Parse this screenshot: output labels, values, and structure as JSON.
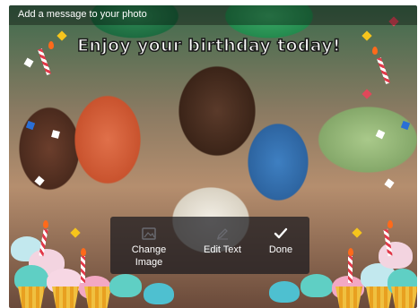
{
  "header": {
    "instruction": "Add a message to your photo"
  },
  "overlay": {
    "banner_text": "Enjoy your birthday today!"
  },
  "toolbar": {
    "change_image_label": "Change\nImage",
    "edit_text_label": "Edit Text",
    "done_label": "Done",
    "icons": {
      "change_image": "photo-icon",
      "edit_text": "pencil-icon",
      "done": "checkmark-icon"
    }
  },
  "colors": {
    "toolbar_bg": "#19191e",
    "banner_text": "#ffffff",
    "banner_outline": "#1a1a1a"
  }
}
